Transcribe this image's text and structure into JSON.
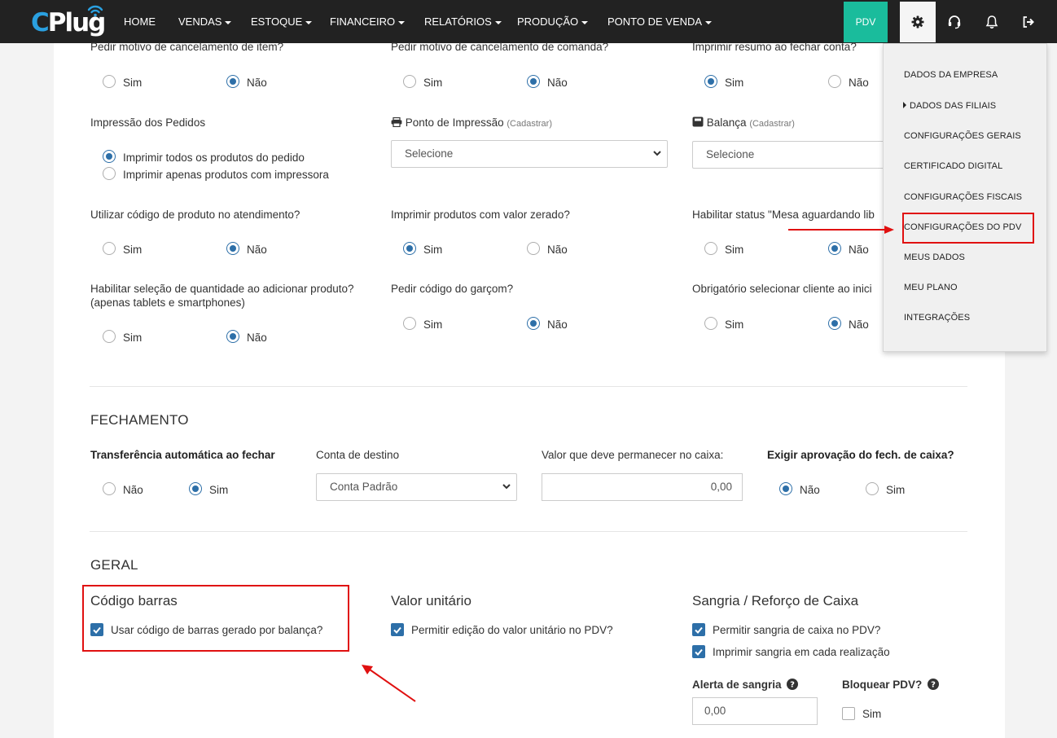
{
  "brand": {
    "logo_text": "CPlug",
    "logo_c": "C",
    "logo_rest": "Plug"
  },
  "nav": {
    "items": [
      {
        "label": "HOME",
        "dropdown": false
      },
      {
        "label": "VENDAS",
        "dropdown": true
      },
      {
        "label": "ESTOQUE",
        "dropdown": true
      },
      {
        "label": "FINANCEIRO",
        "dropdown": true
      },
      {
        "label": "RELATÓRIOS",
        "dropdown": true
      },
      {
        "label": "PRODUÇÃO",
        "dropdown": true
      },
      {
        "label": "PONTO DE VENDA",
        "dropdown": true
      }
    ],
    "pdv_label": "PDV",
    "icons": [
      "gear-icon",
      "headset-icon",
      "bell-icon",
      "logout-icon"
    ]
  },
  "settings_menu": {
    "items": [
      "DADOS DA EMPRESA",
      "DADOS DAS FILIAIS",
      "CONFIGURAÇÕES GERAIS",
      "CERTIFICADO DIGITAL",
      "CONFIGURAÇÕES FISCAIS",
      "CONFIGURAÇÕES DO PDV",
      "MEUS DADOS",
      "MEU PLANO",
      "INTEGRAÇÕES"
    ],
    "highlighted": "CONFIGURAÇÕES DO PDV"
  },
  "options": {
    "yes": "Sim",
    "no": "Não",
    "select_placeholder": "Selecione",
    "cadastrar": "(Cadastrar)"
  },
  "questions": {
    "q1": {
      "label": "Pedir motivo de cancelamento de item?",
      "value": "Não"
    },
    "q2": {
      "label": "Pedir motivo de cancelamento de comanda?",
      "value": "Não"
    },
    "q3": {
      "label": "Imprimir resumo ao fechar conta?",
      "value": "Sim"
    },
    "impressao": {
      "label": "Impressão dos Pedidos",
      "option_all": "Imprimir todos os produtos do pedido",
      "option_printer": "Imprimir apenas produtos com impressora",
      "value": "Imprimir todos os produtos do pedido"
    },
    "ponto_impressao": {
      "label": "Ponto de Impressão",
      "value": "Selecione"
    },
    "balanca": {
      "label": "Balança",
      "value": "Selecione"
    },
    "q4": {
      "label": "Utilizar código de produto no atendimento?",
      "value": "Não"
    },
    "q5": {
      "label": "Imprimir produtos com valor zerado?",
      "value": "Sim"
    },
    "q6": {
      "label": "Habilitar status \"Mesa aguardando lib",
      "value": "Não"
    },
    "q7": {
      "label": "Habilitar seleção de quantidade ao adicionar produto?",
      "sub": "(apenas tablets e smartphones)",
      "value": "Não"
    },
    "q8": {
      "label": "Pedir código do garçom?",
      "value": "Não"
    },
    "q9": {
      "label": "Obrigatório selecionar cliente ao inici",
      "value": "Não"
    }
  },
  "fechamento": {
    "title": "FECHAMENTO",
    "transferencia": {
      "label": "Transferência automática ao fechar",
      "value": "Sim"
    },
    "conta_destino": {
      "label": "Conta de destino",
      "value": "Conta Padrão"
    },
    "valor_caixa": {
      "label": "Valor que deve permanecer no caixa:",
      "value": "0,00"
    },
    "aprovacao": {
      "label": "Exigir aprovação do fech. de caixa?",
      "value": "Não"
    }
  },
  "geral": {
    "title": "GERAL",
    "codigo_barras": {
      "title": "Código barras",
      "checkbox_label": "Usar código de barras gerado por balança?",
      "checked": true
    },
    "valor_unitario": {
      "title": "Valor unitário",
      "checkbox_label": "Permitir edição do valor unitário no PDV?",
      "checked": true
    },
    "sangria": {
      "title": "Sangria / Reforço de Caixa",
      "permitir_label": "Permitir sangria de caixa no PDV?",
      "permitir_checked": true,
      "imprimir_label": "Imprimir sangria em cada realização",
      "imprimir_checked": true,
      "alerta_label": "Alerta de sangria",
      "alerta_value": "0,00",
      "bloquear_label": "Bloquear PDV?",
      "bloquear_option": "Sim",
      "bloquear_checked": false
    }
  },
  "colors": {
    "navbar": "#222222",
    "pdv_button": "#1abc9c",
    "accent": "#2d6fa8",
    "annotation": "#e01010"
  }
}
